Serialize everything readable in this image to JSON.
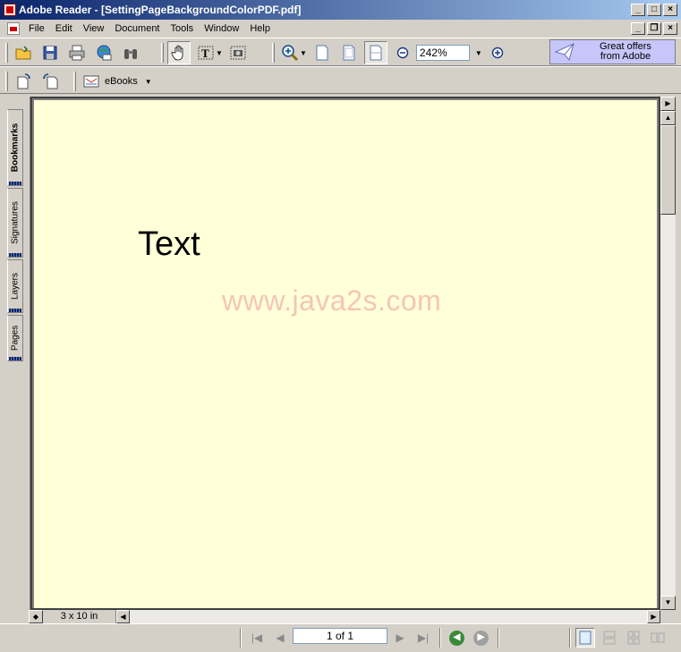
{
  "window": {
    "title": "Adobe Reader - [SettingPageBackgroundColorPDF.pdf]"
  },
  "menu": [
    "File",
    "Edit",
    "View",
    "Document",
    "Tools",
    "Window",
    "Help"
  ],
  "toolbar": {
    "zoom_value": "242%",
    "ebooks_label": "eBooks",
    "offers_line1": "Great offers",
    "offers_line2": "from Adobe"
  },
  "sidebar": {
    "tabs": [
      "Bookmarks",
      "Signatures",
      "Layers",
      "Pages"
    ]
  },
  "document": {
    "text": "Text",
    "watermark": "www.java2s.com",
    "background_color": "#ffffd8"
  },
  "status": {
    "page_size": "3 x 10 in",
    "page_indicator": "1 of 1"
  }
}
